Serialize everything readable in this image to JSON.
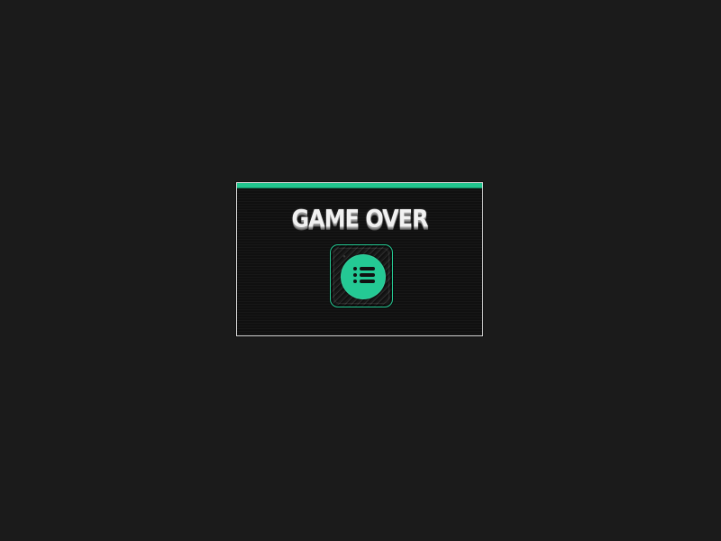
{
  "dialog": {
    "title": "GAME OVER",
    "accent_color": "#22c58e",
    "menu_button": {
      "icon": "list-icon"
    }
  }
}
